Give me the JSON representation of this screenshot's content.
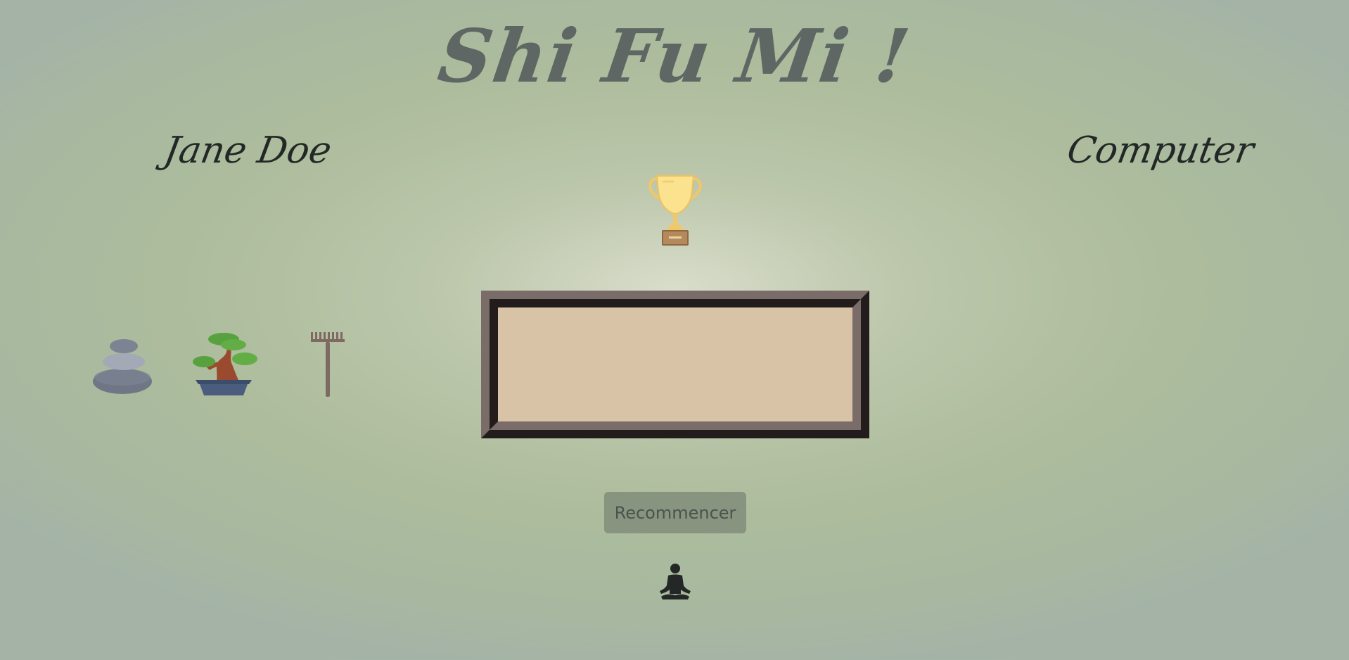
{
  "title": "Shi Fu Mi !",
  "players": {
    "left": "Jane Doe",
    "right": "Computer"
  },
  "icons": {
    "trophy": "trophy-icon",
    "stone": "stone-icon",
    "tree": "bonsai-tree-icon",
    "rake": "rake-icon",
    "meditate": "meditation-icon"
  },
  "result": {
    "text": ""
  },
  "controls": {
    "restart_label": "Recommencer"
  },
  "colors": {
    "title": "#5f6764",
    "frame_light": "#7a6c69",
    "frame_dark": "#221c1c",
    "frame_fill": "#d8c3a7",
    "button": "#87947f"
  }
}
